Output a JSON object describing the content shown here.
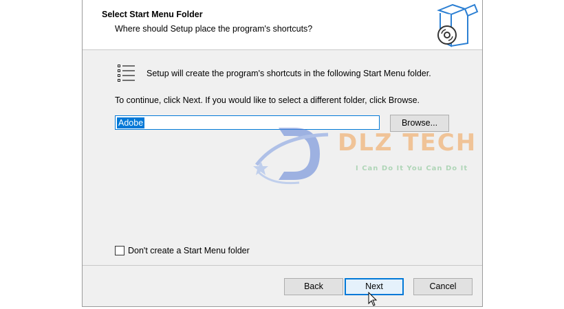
{
  "header": {
    "title": "Select Start Menu Folder",
    "subtitle": "Where should Setup place the program's shortcuts?",
    "icon": "setup-box-icon"
  },
  "body": {
    "info_icon": "start-menu-list-icon",
    "info_text": "Setup will create the program's shortcuts in the following Start Menu folder.",
    "continue_text": "To continue, click Next. If you would like to select a different folder, click Browse.",
    "folder_value": "Adobe",
    "browse_label": "Browse...",
    "checkbox_label": "Don't create a Start Menu folder",
    "checkbox_checked": false
  },
  "footer": {
    "back_label": "Back",
    "next_label": "Next",
    "cancel_label": "Cancel"
  },
  "watermark": {
    "brand": "DLZ TECH",
    "slogan": "I Can Do It You Can Do It"
  },
  "colors": {
    "accent": "#0078d7",
    "watermark_blue": "#5b7fd6",
    "watermark_orange": "#f0a050"
  }
}
